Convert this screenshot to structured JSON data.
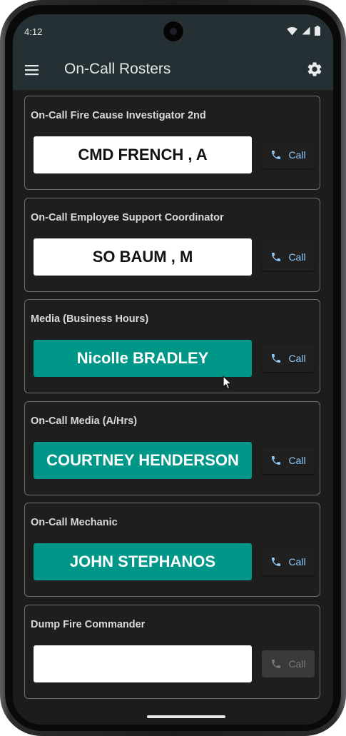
{
  "status_bar": {
    "time": "4:12"
  },
  "app_bar": {
    "title": "On-Call Rosters",
    "menu_icon": "hamburger-menu-icon",
    "settings_icon": "gear-icon"
  },
  "colors": {
    "app_bar": "#243034",
    "background": "#1c1c1c",
    "teal": "#009688",
    "call_text": "#90caf9"
  },
  "rosters": [
    {
      "title": "On-Call Fire Cause Investigator 2nd",
      "name": "CMD FRENCH , A",
      "style": "white",
      "call_label": "Call",
      "call_enabled": true
    },
    {
      "title": "On-Call Employee Support Coordinator",
      "name": "SO BAUM , M",
      "style": "white",
      "call_label": "Call",
      "call_enabled": true
    },
    {
      "title": "Media (Business Hours)",
      "name": "Nicolle BRADLEY",
      "style": "teal",
      "call_label": "Call",
      "call_enabled": true
    },
    {
      "title": "On-Call Media (A/Hrs)",
      "name": "COURTNEY HENDERSON",
      "style": "teal",
      "call_label": "Call",
      "call_enabled": true
    },
    {
      "title": "On-Call Mechanic",
      "name": "JOHN STEPHANOS",
      "style": "teal",
      "call_label": "Call",
      "call_enabled": true
    },
    {
      "title": "Dump Fire Commander",
      "name": "",
      "style": "white",
      "call_label": "Call",
      "call_enabled": false
    }
  ]
}
